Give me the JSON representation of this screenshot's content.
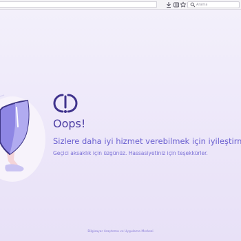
{
  "browser": {
    "search_placeholder": "Arama"
  },
  "error_page": {
    "title": "Oops!",
    "subtitle": "Sizlere daha iyi hizmet verebilmek için iyileştirme çalışmaları",
    "description": "Geçici aksaklık için üzgünüz. Hassasiyetiniz için teşekkürler.",
    "footer": "Bilgisayar Araştırma ve Uygulama Merkezi"
  },
  "colors": {
    "accent": "#4d3fa3",
    "text_light": "#6a5fd0",
    "background": "#efeaf8"
  },
  "icons": [
    "download-icon",
    "library-icon",
    "bookmark-star-icon",
    "search-icon",
    "shield-icon",
    "brand-logo-icon"
  ]
}
